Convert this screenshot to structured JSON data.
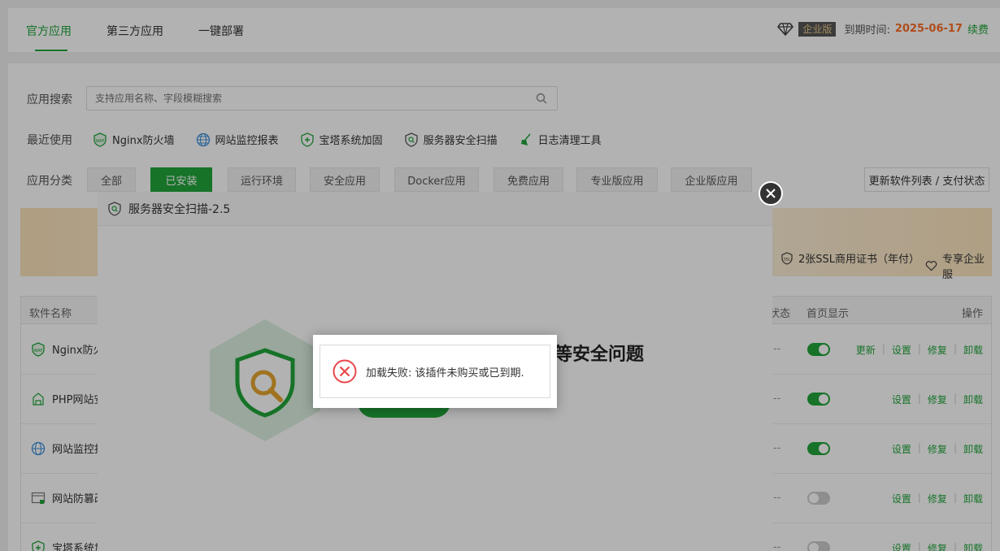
{
  "tabs": [
    {
      "label": "官方应用",
      "active": true
    },
    {
      "label": "第三方应用",
      "active": false
    },
    {
      "label": "一键部署",
      "active": false
    }
  ],
  "header": {
    "badge": "企业版",
    "expire_label": "到期时间:",
    "expire_date": "2025-06-17",
    "renew": "续费"
  },
  "search": {
    "label": "应用搜索",
    "placeholder": "支持应用名称、字段模糊搜索"
  },
  "recent": {
    "label": "最近使用",
    "items": [
      {
        "label": "Nginx防火墙",
        "icon": "waf-icon"
      },
      {
        "label": "网站监控报表",
        "icon": "globe-icon"
      },
      {
        "label": "宝塔系统加固",
        "icon": "shield-plus-icon"
      },
      {
        "label": "服务器安全扫描",
        "icon": "shield-search-icon"
      },
      {
        "label": "日志清理工具",
        "icon": "broom-icon"
      }
    ]
  },
  "categories": {
    "label": "应用分类",
    "items": [
      {
        "label": "全部",
        "active": false
      },
      {
        "label": "已安装",
        "active": true
      },
      {
        "label": "运行环境",
        "active": false
      },
      {
        "label": "安全应用",
        "active": false
      },
      {
        "label": "Docker应用",
        "active": false
      },
      {
        "label": "免费应用",
        "active": false
      },
      {
        "label": "专业版应用",
        "active": false
      },
      {
        "label": "企业版应用",
        "active": false
      }
    ],
    "refresh": "更新软件列表 / 支付状态"
  },
  "banner": {
    "perk_ssl": "2张SSL商用证书（年付）",
    "perk_enterprise": "专享企业服"
  },
  "table": {
    "headers": {
      "name": "软件名称",
      "status": "状态",
      "home": "首页显示",
      "ops": "操作"
    },
    "rows": [
      {
        "name": "Nginx防火",
        "home_on": true,
        "ops": [
          "更新",
          "设置",
          "修复",
          "卸载"
        ]
      },
      {
        "name": "PHP网站安",
        "home_on": true,
        "ops": [
          "设置",
          "修复",
          "卸载"
        ]
      },
      {
        "name": "网站监控报",
        "home_on": true,
        "ops": [
          "设置",
          "修复",
          "卸载"
        ]
      },
      {
        "name": "网站防篡改",
        "home_on": false,
        "ops": [
          "设置",
          "修复",
          "卸载"
        ]
      },
      {
        "name": "宝塔系统加",
        "home_on": false,
        "ops": [
          "设置",
          "修复",
          "卸载"
        ]
      }
    ],
    "dash": "--"
  },
  "modal": {
    "title": "服务器安全扫描-2.5",
    "heading": "等安全问题"
  },
  "toast": {
    "message": "加载失败: 该插件未购买或已到期."
  },
  "colors": {
    "accent": "#20a53a",
    "expire": "#fc6d26",
    "error": "#e8474a"
  }
}
